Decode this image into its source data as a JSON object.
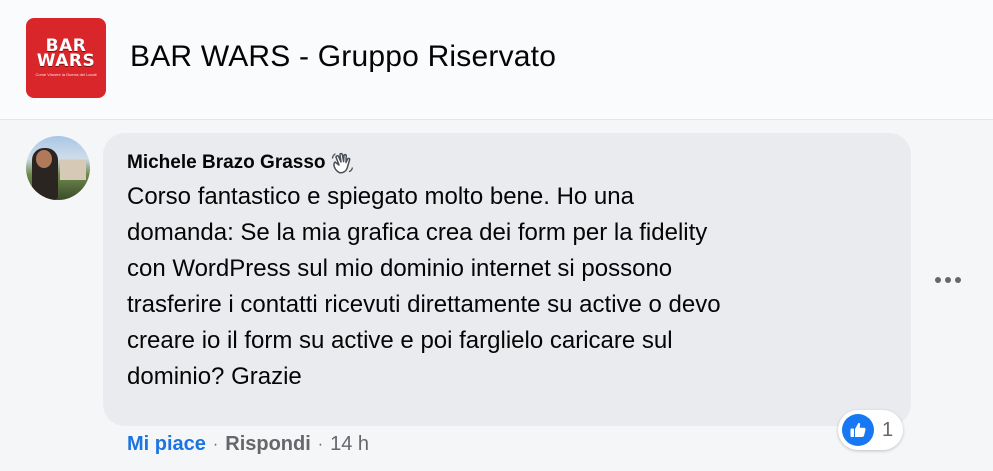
{
  "group": {
    "logo_line1": "BAR",
    "logo_line2": "WARS",
    "logo_tagline": "Come Vincere la Guerra dei Locali",
    "title": "BAR WARS - Gruppo Riservato"
  },
  "comment": {
    "author": "Michele Brazo Grasso",
    "author_badge_icon": "waving-hand-icon",
    "text": "Corso fantastico e spiegato molto bene. Ho una\ndomanda: Se la mia grafica crea dei form per la fidelity\ncon WordPress sul mio dominio internet si possono\ntrasferire i contatti ricevuti direttamente su active o devo\ncreare io il form su active e poi farglielo caricare sul\ndominio? Grazie",
    "more_icon": "more-options-icon"
  },
  "actions": {
    "like_label": "Mi piace",
    "separator": "·",
    "reply_label": "Rispondi",
    "time": "14 h"
  },
  "reactions": {
    "icon": "thumbs-up-icon",
    "count": "1"
  },
  "colors": {
    "accent": "#1b74e4",
    "like_badge": "#1877f2",
    "logo_red": "#d8262b",
    "bubble": "#e9ebee",
    "secondary_text": "#65676b"
  }
}
